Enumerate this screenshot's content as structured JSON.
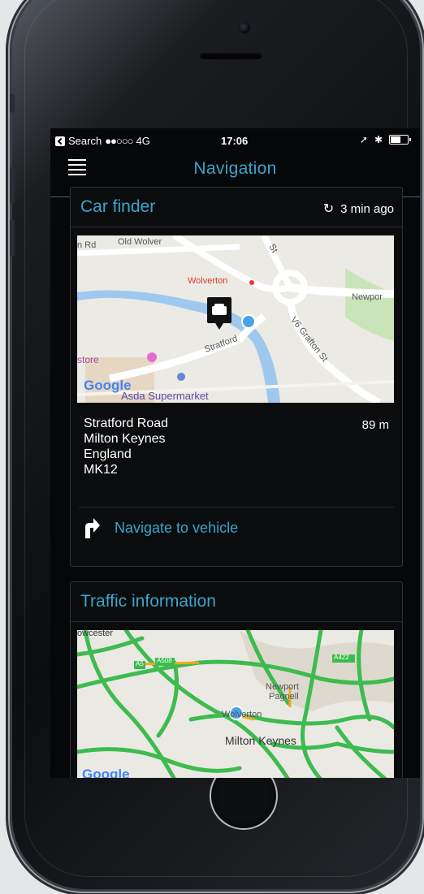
{
  "statusbar": {
    "back_label": "Search",
    "signal": "●●○○○",
    "network": "4G",
    "time": "17:06",
    "location_glyph": "➚",
    "bluetooth_glyph": "✱"
  },
  "navbar": {
    "title": "Navigation",
    "pages": 4,
    "active_page": 2
  },
  "car_finder": {
    "title": "Car finder",
    "updated": "3 min ago",
    "map_labels": {
      "road1": "n Rd",
      "road2": "Old Wolver",
      "station": "Wolverton",
      "newport": "Newpor",
      "stratford": "Stratford",
      "grafton": "V6 Grafton St",
      "store": "store",
      "asda": "Asda Supermarket",
      "google": "Google",
      "st": "St"
    },
    "address": [
      "Stratford Road",
      "Milton Keynes",
      "England",
      "MK12"
    ],
    "distance": "89 m",
    "action_label": "Navigate to vehicle"
  },
  "traffic": {
    "title": "Traffic information",
    "map_labels": {
      "towcester": "owcester",
      "a5": "A5",
      "a508": "A508",
      "a422": "A422",
      "newport": "Newport",
      "pagnell": "Pagnell",
      "wolverton": "Wolverton",
      "milton_keynes": "Milton Keynes",
      "google": "Google"
    }
  },
  "colors": {
    "accent": "#3aa6cc",
    "screen_bg": "#060709",
    "map_green": "#3dbb4f",
    "map_blue": "#4aa3e8"
  }
}
